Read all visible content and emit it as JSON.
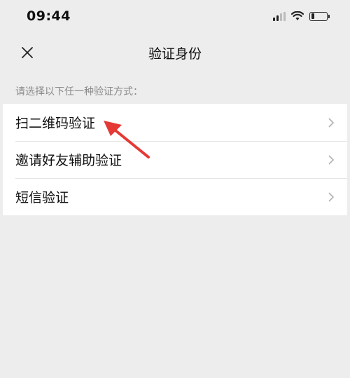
{
  "status_bar": {
    "time": "09:44"
  },
  "nav": {
    "title": "验证身份"
  },
  "hint": "请选择以下任一种验证方式：",
  "options": [
    {
      "label": "扫二维码验证"
    },
    {
      "label": "邀请好友辅助验证"
    },
    {
      "label": "短信验证"
    }
  ],
  "colors": {
    "background": "#ededed",
    "list_background": "#ffffff",
    "hint_text": "#8a8a8a",
    "annotation_arrow": "#e53935"
  },
  "icons": [
    "close-icon",
    "chevron-right-icon",
    "wifi-icon",
    "signal-icon",
    "battery-icon"
  ]
}
